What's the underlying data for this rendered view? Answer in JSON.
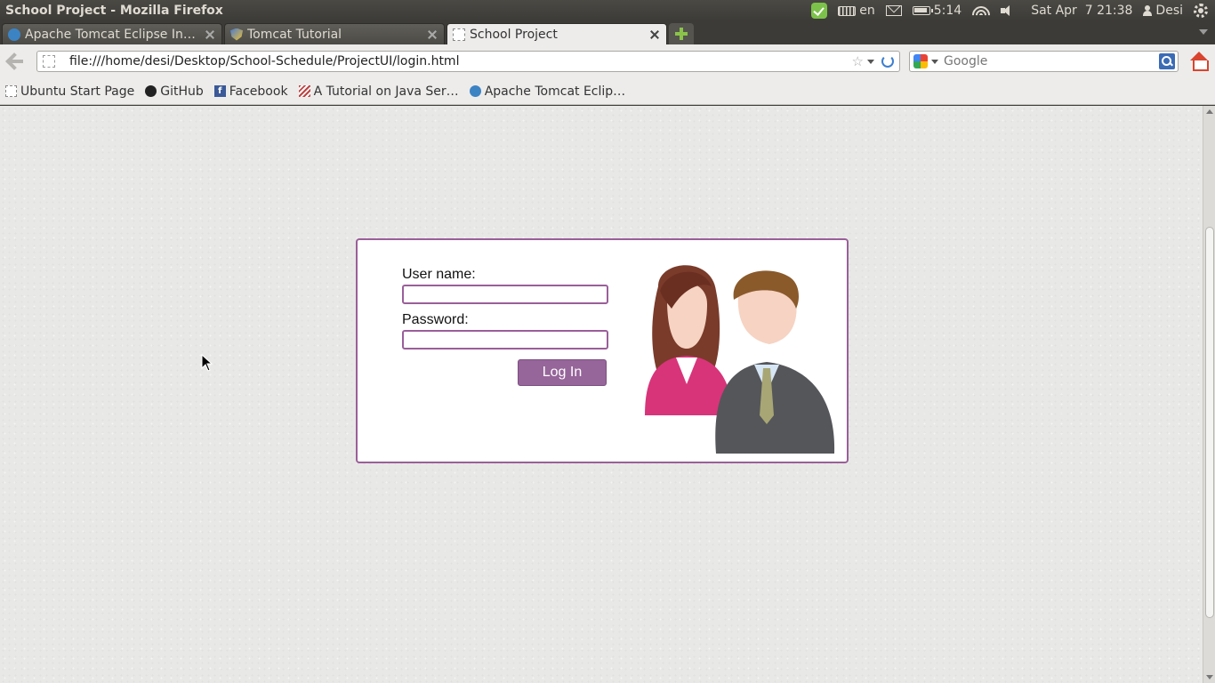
{
  "window": {
    "title": "School Project - Mozilla Firefox"
  },
  "tray": {
    "keyboard_lang": "en",
    "battery_time": "5:14",
    "datetime": "Sat Apr  7 21:38",
    "user": "Desi"
  },
  "tabs": [
    {
      "label": "Apache Tomcat Eclipse Inte…",
      "active": false,
      "icon": "maven-icon"
    },
    {
      "label": "Tomcat Tutorial",
      "active": false,
      "icon": "shield-icon"
    },
    {
      "label": "School Project",
      "active": true,
      "icon": "blank-page-icon"
    }
  ],
  "navbar": {
    "url": "file:///home/desi/Desktop/School-Schedule/ProjectUI/login.html",
    "search_placeholder": "Google"
  },
  "bookmarks": [
    {
      "label": "Ubuntu Start Page",
      "icon": "blank-page-icon"
    },
    {
      "label": "GitHub",
      "icon": "github-icon"
    },
    {
      "label": "Facebook",
      "icon": "facebook-icon"
    },
    {
      "label": "A Tutorial on Java Ser…",
      "icon": "tutorial-icon"
    },
    {
      "label": "Apache Tomcat Eclip…",
      "icon": "maven-icon"
    }
  ],
  "login": {
    "username_label": "User name:",
    "username_value": "",
    "password_label": "Password:",
    "password_value": "",
    "submit_label": "Log In"
  },
  "colors": {
    "accent": "#9a5f99",
    "button": "#96659a"
  }
}
